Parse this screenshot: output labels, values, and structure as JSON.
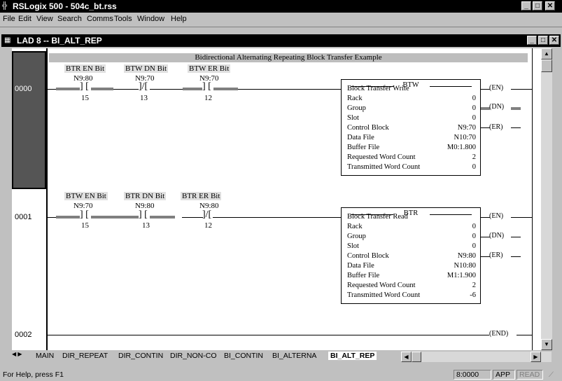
{
  "app": {
    "title": "RSLogix 500 - 504c_bt.rss",
    "icon": "plc-icon",
    "window_buttons": [
      "_",
      "□",
      "✕"
    ]
  },
  "menu": [
    "File",
    "Edit",
    "View",
    "Search",
    "Comms",
    "Tools",
    "Window",
    "Help"
  ],
  "ladder_window": {
    "title": "LAD 8 -- BI_ALT_REP",
    "buttons": [
      "_",
      "□",
      "✕"
    ]
  },
  "rung_comment": "Bidirectional Alternating Repeating Block Transfer Example",
  "rungs": [
    {
      "number": "0000",
      "contacts": [
        {
          "desc": "BTR EN Bit",
          "addr": "N9:80",
          "bit": "15",
          "type": "XIC"
        },
        {
          "desc": "BTW DN Bit",
          "addr": "N9:70",
          "bit": "13",
          "type": "XIO"
        },
        {
          "desc": "BTW ER Bit",
          "addr": "N9:70",
          "bit": "12",
          "type": "XIC"
        }
      ],
      "block": {
        "mnemonic": "BTW",
        "name": "Block Transfer Write",
        "rows": [
          {
            "k": "Rack",
            "v": "0"
          },
          {
            "k": "Group",
            "v": "0"
          },
          {
            "k": "Slot",
            "v": "0"
          },
          {
            "k": "Control Block",
            "v": "N9:70"
          },
          {
            "k": "Data File",
            "v": "N10:70"
          },
          {
            "k": "Buffer File",
            "v": "M0:1.800"
          },
          {
            "k": "Requested Word Count",
            "v": "2"
          },
          {
            "k": "Transmitted Word Count",
            "v": "0"
          }
        ],
        "outputs": [
          "EN",
          "DN",
          "ER"
        ]
      }
    },
    {
      "number": "0001",
      "contacts": [
        {
          "desc": "BTW EN Bit",
          "addr": "N9:70",
          "bit": "15",
          "type": "XIC"
        },
        {
          "desc": "BTR DN Bit",
          "addr": "N9:80",
          "bit": "13",
          "type": "XIC"
        },
        {
          "desc": "BTR ER Bit",
          "addr": "N9:80",
          "bit": "12",
          "type": "XIO"
        }
      ],
      "block": {
        "mnemonic": "BTR",
        "name": "Block Transfer Read",
        "rows": [
          {
            "k": "Rack",
            "v": "0"
          },
          {
            "k": "Group",
            "v": "0"
          },
          {
            "k": "Slot",
            "v": "0"
          },
          {
            "k": "Control Block",
            "v": "N9:80"
          },
          {
            "k": "Data File",
            "v": "N10:80"
          },
          {
            "k": "Buffer File",
            "v": "M1:1.900"
          },
          {
            "k": "Requested Word Count",
            "v": "2"
          },
          {
            "k": "Transmitted Word Count",
            "v": "-6"
          }
        ],
        "outputs": [
          "EN",
          "DN",
          "ER"
        ]
      }
    },
    {
      "number": "0002",
      "end_label": "END"
    }
  ],
  "tabs": [
    "MAIN",
    "DIR_REPEAT",
    "DIR_CONTIN",
    "DIR_NON-CO",
    "BI_CONTIN",
    "BI_ALTERNA",
    "BI_ALT_REP"
  ],
  "active_tab": "BI_ALT_REP",
  "status": {
    "help": "For Help, press F1",
    "address": "8:0000",
    "mode": "APP",
    "read": "READ"
  }
}
